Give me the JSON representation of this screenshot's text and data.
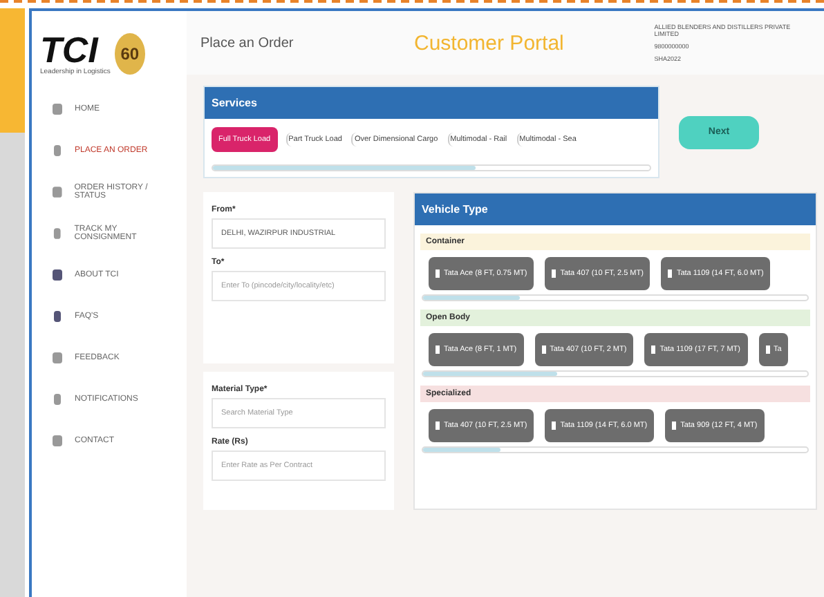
{
  "brand": {
    "logo": "TCI",
    "tagline": "Leadership in Logistics",
    "badge": "60"
  },
  "header": {
    "page_title": "Place an Order",
    "portal_title": "Customer Portal",
    "user": [
      "ALLIED BLENDERS AND DISTILLERS PRIVATE LIMITED",
      "9800000000",
      "SHA2022"
    ]
  },
  "sidebar": {
    "items": [
      {
        "label": "HOME",
        "selected": false
      },
      {
        "label": "PLACE AN ORDER",
        "selected": true
      },
      {
        "label": "ORDER HISTORY / STATUS",
        "selected": false
      },
      {
        "label": "TRACK MY CONSIGNMENT",
        "selected": false
      },
      {
        "label": "ABOUT TCI",
        "selected": false
      },
      {
        "label": "FAQ'S",
        "selected": false
      },
      {
        "label": "FEEDBACK",
        "selected": false
      },
      {
        "label": "NOTIFICATIONS",
        "selected": false
      },
      {
        "label": "CONTACT",
        "selected": false
      }
    ]
  },
  "services": {
    "title": "Services",
    "options": [
      {
        "label": "Full Truck Load",
        "selected": true
      },
      {
        "label": "Part Truck Load",
        "selected": false
      },
      {
        "label": "Over Dimensional Cargo",
        "selected": false
      },
      {
        "label": "Multimodal - Rail",
        "selected": false
      },
      {
        "label": "Multimodal - Sea",
        "selected": false
      }
    ]
  },
  "next_button": "Next",
  "form": {
    "fields": [
      {
        "label": "From*",
        "value": "DELHI, WAZIRPUR INDUSTRIAL"
      },
      {
        "label": "To*",
        "placeholder": "Enter To (pincode/city/locality/etc)"
      },
      {
        "label": "Material Type*",
        "placeholder": "Search Material Type"
      },
      {
        "label": "Rate (Rs)",
        "placeholder": "Enter Rate as Per Contract"
      }
    ]
  },
  "vehicle_type": {
    "title": "Vehicle Type",
    "groups": [
      {
        "name": "Container",
        "color": "#fbf3dc",
        "vehicles": [
          "Tata Ace (8 FT, 0.75 MT)",
          "Tata 407 (10 FT, 2.5 MT)",
          "Tata 1109 (14 FT, 6.0 MT)"
        ]
      },
      {
        "name": "Open Body",
        "color": "#e3f1dc",
        "vehicles": [
          "Tata Ace (8 FT, 1 MT)",
          "Tata 407 (10 FT, 2 MT)",
          "Tata 1109 (17 FT, 7 MT)",
          "Ta"
        ]
      },
      {
        "name": "Specialized",
        "color": "#f6e0e0",
        "vehicles": [
          "Tata 407 (10 FT, 2.5 MT)",
          "Tata 1109 (14 FT, 6.0 MT)",
          "Tata 909 (12 FT, 4 MT)"
        ]
      }
    ]
  }
}
